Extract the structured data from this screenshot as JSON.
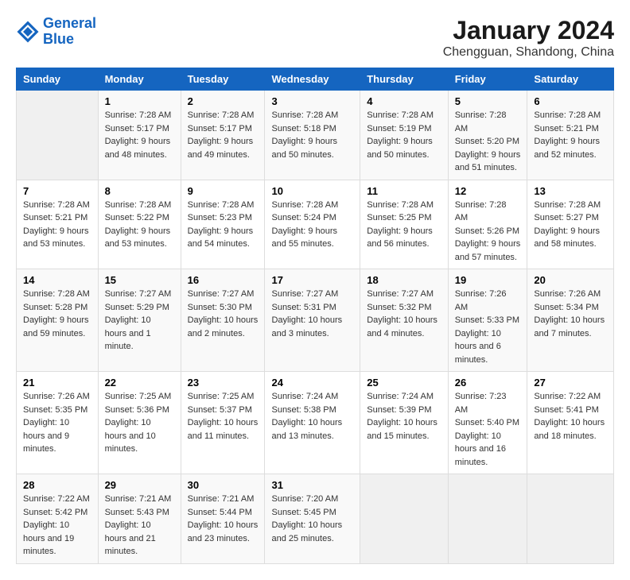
{
  "logo": {
    "line1": "General",
    "line2": "Blue"
  },
  "title": "January 2024",
  "subtitle": "Chengguan, Shandong, China",
  "days_header": [
    "Sunday",
    "Monday",
    "Tuesday",
    "Wednesday",
    "Thursday",
    "Friday",
    "Saturday"
  ],
  "weeks": [
    [
      {
        "num": "",
        "sunrise": "",
        "sunset": "",
        "daylight": "",
        "empty": true
      },
      {
        "num": "1",
        "sunrise": "Sunrise: 7:28 AM",
        "sunset": "Sunset: 5:17 PM",
        "daylight": "Daylight: 9 hours and 48 minutes."
      },
      {
        "num": "2",
        "sunrise": "Sunrise: 7:28 AM",
        "sunset": "Sunset: 5:17 PM",
        "daylight": "Daylight: 9 hours and 49 minutes."
      },
      {
        "num": "3",
        "sunrise": "Sunrise: 7:28 AM",
        "sunset": "Sunset: 5:18 PM",
        "daylight": "Daylight: 9 hours and 50 minutes."
      },
      {
        "num": "4",
        "sunrise": "Sunrise: 7:28 AM",
        "sunset": "Sunset: 5:19 PM",
        "daylight": "Daylight: 9 hours and 50 minutes."
      },
      {
        "num": "5",
        "sunrise": "Sunrise: 7:28 AM",
        "sunset": "Sunset: 5:20 PM",
        "daylight": "Daylight: 9 hours and 51 minutes."
      },
      {
        "num": "6",
        "sunrise": "Sunrise: 7:28 AM",
        "sunset": "Sunset: 5:21 PM",
        "daylight": "Daylight: 9 hours and 52 minutes."
      }
    ],
    [
      {
        "num": "7",
        "sunrise": "Sunrise: 7:28 AM",
        "sunset": "Sunset: 5:21 PM",
        "daylight": "Daylight: 9 hours and 53 minutes."
      },
      {
        "num": "8",
        "sunrise": "Sunrise: 7:28 AM",
        "sunset": "Sunset: 5:22 PM",
        "daylight": "Daylight: 9 hours and 53 minutes."
      },
      {
        "num": "9",
        "sunrise": "Sunrise: 7:28 AM",
        "sunset": "Sunset: 5:23 PM",
        "daylight": "Daylight: 9 hours and 54 minutes."
      },
      {
        "num": "10",
        "sunrise": "Sunrise: 7:28 AM",
        "sunset": "Sunset: 5:24 PM",
        "daylight": "Daylight: 9 hours and 55 minutes."
      },
      {
        "num": "11",
        "sunrise": "Sunrise: 7:28 AM",
        "sunset": "Sunset: 5:25 PM",
        "daylight": "Daylight: 9 hours and 56 minutes."
      },
      {
        "num": "12",
        "sunrise": "Sunrise: 7:28 AM",
        "sunset": "Sunset: 5:26 PM",
        "daylight": "Daylight: 9 hours and 57 minutes."
      },
      {
        "num": "13",
        "sunrise": "Sunrise: 7:28 AM",
        "sunset": "Sunset: 5:27 PM",
        "daylight": "Daylight: 9 hours and 58 minutes."
      }
    ],
    [
      {
        "num": "14",
        "sunrise": "Sunrise: 7:28 AM",
        "sunset": "Sunset: 5:28 PM",
        "daylight": "Daylight: 9 hours and 59 minutes."
      },
      {
        "num": "15",
        "sunrise": "Sunrise: 7:27 AM",
        "sunset": "Sunset: 5:29 PM",
        "daylight": "Daylight: 10 hours and 1 minute."
      },
      {
        "num": "16",
        "sunrise": "Sunrise: 7:27 AM",
        "sunset": "Sunset: 5:30 PM",
        "daylight": "Daylight: 10 hours and 2 minutes."
      },
      {
        "num": "17",
        "sunrise": "Sunrise: 7:27 AM",
        "sunset": "Sunset: 5:31 PM",
        "daylight": "Daylight: 10 hours and 3 minutes."
      },
      {
        "num": "18",
        "sunrise": "Sunrise: 7:27 AM",
        "sunset": "Sunset: 5:32 PM",
        "daylight": "Daylight: 10 hours and 4 minutes."
      },
      {
        "num": "19",
        "sunrise": "Sunrise: 7:26 AM",
        "sunset": "Sunset: 5:33 PM",
        "daylight": "Daylight: 10 hours and 6 minutes."
      },
      {
        "num": "20",
        "sunrise": "Sunrise: 7:26 AM",
        "sunset": "Sunset: 5:34 PM",
        "daylight": "Daylight: 10 hours and 7 minutes."
      }
    ],
    [
      {
        "num": "21",
        "sunrise": "Sunrise: 7:26 AM",
        "sunset": "Sunset: 5:35 PM",
        "daylight": "Daylight: 10 hours and 9 minutes."
      },
      {
        "num": "22",
        "sunrise": "Sunrise: 7:25 AM",
        "sunset": "Sunset: 5:36 PM",
        "daylight": "Daylight: 10 hours and 10 minutes."
      },
      {
        "num": "23",
        "sunrise": "Sunrise: 7:25 AM",
        "sunset": "Sunset: 5:37 PM",
        "daylight": "Daylight: 10 hours and 11 minutes."
      },
      {
        "num": "24",
        "sunrise": "Sunrise: 7:24 AM",
        "sunset": "Sunset: 5:38 PM",
        "daylight": "Daylight: 10 hours and 13 minutes."
      },
      {
        "num": "25",
        "sunrise": "Sunrise: 7:24 AM",
        "sunset": "Sunset: 5:39 PM",
        "daylight": "Daylight: 10 hours and 15 minutes."
      },
      {
        "num": "26",
        "sunrise": "Sunrise: 7:23 AM",
        "sunset": "Sunset: 5:40 PM",
        "daylight": "Daylight: 10 hours and 16 minutes."
      },
      {
        "num": "27",
        "sunrise": "Sunrise: 7:22 AM",
        "sunset": "Sunset: 5:41 PM",
        "daylight": "Daylight: 10 hours and 18 minutes."
      }
    ],
    [
      {
        "num": "28",
        "sunrise": "Sunrise: 7:22 AM",
        "sunset": "Sunset: 5:42 PM",
        "daylight": "Daylight: 10 hours and 19 minutes."
      },
      {
        "num": "29",
        "sunrise": "Sunrise: 7:21 AM",
        "sunset": "Sunset: 5:43 PM",
        "daylight": "Daylight: 10 hours and 21 minutes."
      },
      {
        "num": "30",
        "sunrise": "Sunrise: 7:21 AM",
        "sunset": "Sunset: 5:44 PM",
        "daylight": "Daylight: 10 hours and 23 minutes."
      },
      {
        "num": "31",
        "sunrise": "Sunrise: 7:20 AM",
        "sunset": "Sunset: 5:45 PM",
        "daylight": "Daylight: 10 hours and 25 minutes."
      },
      {
        "num": "",
        "sunrise": "",
        "sunset": "",
        "daylight": "",
        "empty": true
      },
      {
        "num": "",
        "sunrise": "",
        "sunset": "",
        "daylight": "",
        "empty": true
      },
      {
        "num": "",
        "sunrise": "",
        "sunset": "",
        "daylight": "",
        "empty": true
      }
    ]
  ]
}
